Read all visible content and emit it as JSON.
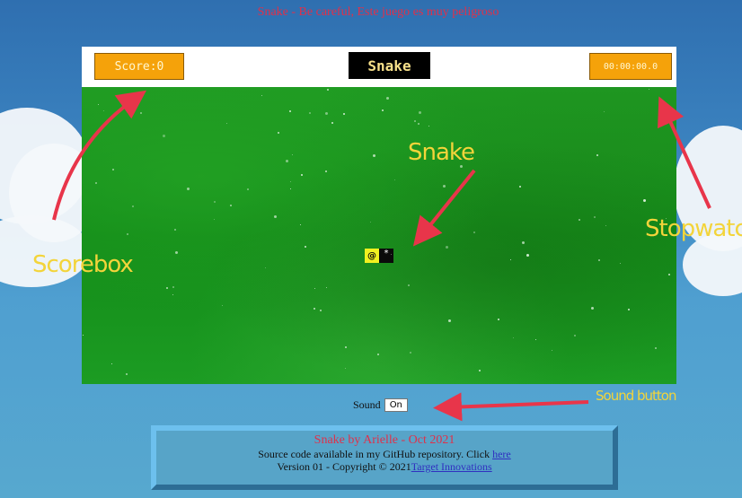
{
  "page": {
    "heading": "Snake - Be careful, Este juego es muy peligroso"
  },
  "header": {
    "score_text": "Score:0",
    "title": "Snake",
    "stopwatch": "00:00:00.0"
  },
  "board": {
    "snake_head_glyph": "@",
    "snake_tail_glyph": "*"
  },
  "annotations": {
    "scorebox": "Scorebox",
    "snake": "Snake",
    "stopwatch": "Stopwatch",
    "sound_button": "Sound button"
  },
  "sound": {
    "label": "Sound",
    "button": "On"
  },
  "footer": {
    "title": "Snake by Arielle - Oct 2021",
    "source_text": "Source code available in my GitHub repository. Click ",
    "source_link": "here",
    "version_text": "Version 01 - Copyright © 2021",
    "version_link": "Target Innovations"
  },
  "colors": {
    "accent_orange": "#f5a20a",
    "annotation_yellow": "#f3d43a",
    "arrow_red": "#e8354a",
    "title_red": "#e0304a"
  }
}
